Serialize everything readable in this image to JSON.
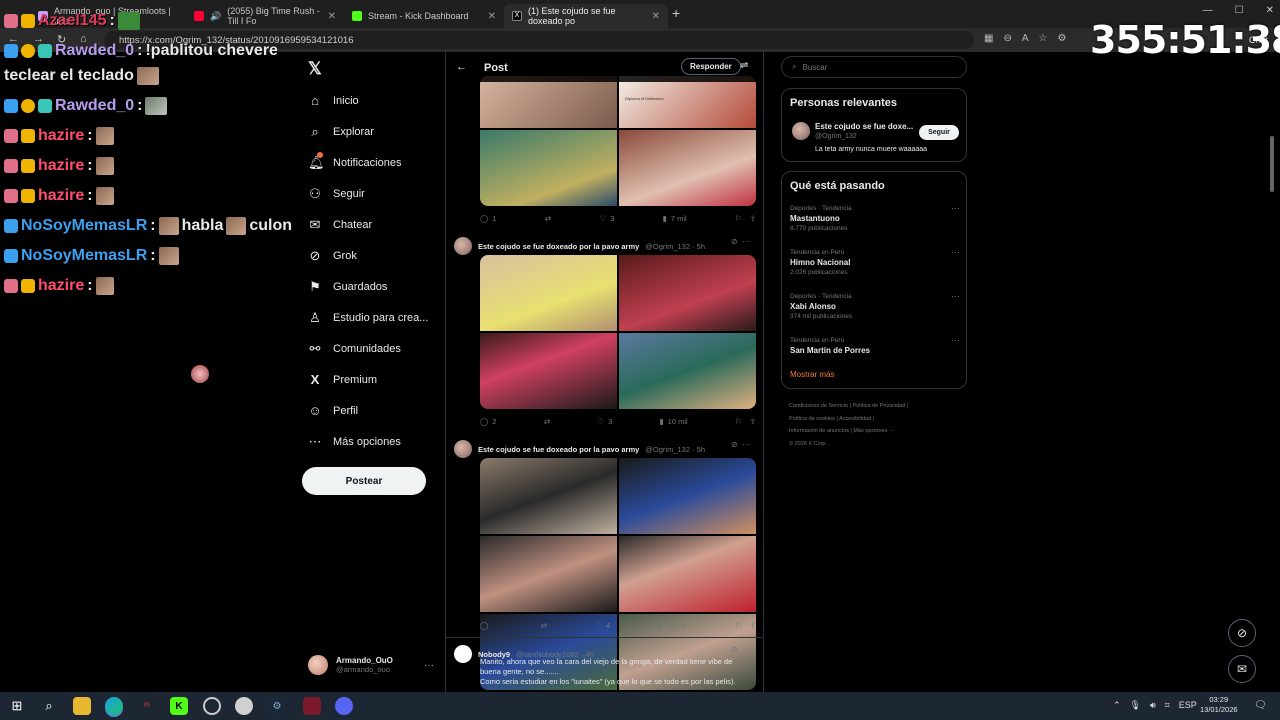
{
  "browser": {
    "tabs": [
      {
        "title": "Armando_ouo | Streamloots | Inte",
        "fav_color": "#c9a0ff"
      },
      {
        "title": "(2055) Big Time Rush - Till I Fo",
        "fav_color": "#ff0033"
      },
      {
        "title": "Stream - Kick Dashboard",
        "fav_color": "#53fc18"
      },
      {
        "title": "(1) Este cojudo se fue doxeado po",
        "fav_color": "#000000"
      }
    ],
    "url": "https://x.com/Ogrim_132/status/2010916959534121016",
    "chat_label": "Chat"
  },
  "stream_timer": "355:51:38",
  "chat": [
    {
      "user": "Azael145",
      "sep": ":",
      "color": "#e03a5a",
      "text": ""
    },
    {
      "user": "Rawded_0",
      "sep": ":",
      "color": "#b99cf0",
      "text": "!pablitou chevere"
    },
    {
      "user": "",
      "sep": "",
      "color": "#ffffff",
      "text": "teclear el teclado"
    },
    {
      "user": "Rawded_0",
      "sep": ":",
      "color": "#b99cf0",
      "text": ""
    },
    {
      "user": "hazire",
      "sep": ":",
      "color": "#ff4d6d",
      "text": ""
    },
    {
      "user": "hazire",
      "sep": ":",
      "color": "#ff4d6d",
      "text": ""
    },
    {
      "user": "hazire",
      "sep": ":",
      "color": "#ff4d6d",
      "text": ""
    },
    {
      "user": "NoSoyMemasLR",
      "sep": ":",
      "color": "#3ba0f0",
      "text": "habla",
      "text2": "culon"
    },
    {
      "user": "NoSoyMemasLR",
      "sep": ":",
      "color": "#3ba0f0",
      "text": ""
    },
    {
      "user": "hazire",
      "sep": ":",
      "color": "#ff4d6d",
      "text": ""
    }
  ],
  "x_nav": {
    "items": [
      {
        "label": "Inicio",
        "icon": "home-icon"
      },
      {
        "label": "Explorar",
        "icon": "search-icon"
      },
      {
        "label": "Notificaciones",
        "icon": "bell-icon"
      },
      {
        "label": "Seguir",
        "icon": "person-add-icon"
      },
      {
        "label": "Chatear",
        "icon": "chat-icon"
      },
      {
        "label": "Grok",
        "icon": "grok-icon"
      },
      {
        "label": "Guardados",
        "icon": "bookmark-icon"
      },
      {
        "label": "Estudio para crea...",
        "icon": "studio-icon"
      },
      {
        "label": "Comunidades",
        "icon": "communities-icon"
      },
      {
        "label": "Premium",
        "icon": "x-premium-icon"
      },
      {
        "label": "Perfil",
        "icon": "profile-icon"
      },
      {
        "label": "Más opciones",
        "icon": "more-icon"
      }
    ],
    "post_button": "Postear",
    "account_name": "Armando_OuO",
    "account_handle": "@armando_ouo"
  },
  "post_view": {
    "title": "Post",
    "reply_button": "Responder",
    "tweets": [
      {
        "actions": {
          "replies": "1",
          "likes": "3",
          "views": "7 mil"
        }
      },
      {
        "name": "Este cojudo se fue doxeado por la pavo army",
        "handle": "@Ogrim_132 · 5h",
        "actions": {
          "replies": "2",
          "likes": "3",
          "views": "10 mil"
        }
      },
      {
        "name": "Este cojudo se fue doxeado por la pavo army",
        "handle": "@Ogrim_132 · 5h",
        "actions": {
          "replies": "",
          "likes": "4",
          "views": "10 mil"
        }
      }
    ],
    "image_text": "Diploma of Distinction",
    "reply": {
      "name": "Nobody9",
      "handle": "@IamNobody1082 · 4h",
      "lines": [
        "Manito, ahora que veo la cara del viejo de la gringa, de verdad tiene vibe de",
        "buena gente, no se.......",
        "Como seria estudiar en los \"iunaites\" (ya que lo que se todo es por las pelis)."
      ]
    }
  },
  "sidebar": {
    "search_placeholder": "Buscar",
    "relevant": {
      "title": "Personas relevantes",
      "name": "Este cojudo se fue doxe...",
      "handle": "@Ogrim_132",
      "bio": "La teta army nunca muere waaaaaa",
      "follow": "Seguir"
    },
    "trends_title": "Qué está pasando",
    "trends": [
      {
        "context": "Deportes · Tendencia",
        "name": "Mastantuono",
        "count": "8.770 publicaciones"
      },
      {
        "context": "Tendencia en Perú",
        "name": "Himno Nacional",
        "count": "2.026 publicaciones"
      },
      {
        "context": "Deportes · Tendencia",
        "name": "Xabi Alonso",
        "count": "374 mil publicaciones"
      },
      {
        "context": "Tendencia en Perú",
        "name": "San Martín de Porres",
        "count": ""
      }
    ],
    "show_more": "Mostrar más",
    "footer": [
      "Condiciones de Servicio |  Política de Privacidad |",
      "Política de cookies |  Accesibilidad |",
      "Información de anuncios |  Más opciones ···",
      "© 2026 X Corp."
    ]
  },
  "taskbar": {
    "lang": "ESP",
    "time": "03:29",
    "date": "13/01/2026"
  },
  "colors": {
    "accent_orange": "#f07a3c",
    "x_bg": "#000000",
    "border": "#2f3336"
  }
}
